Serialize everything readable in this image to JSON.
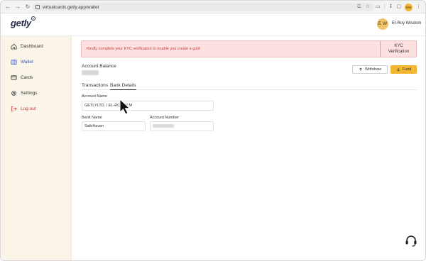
{
  "browser": {
    "url": "virtualcards.getly.app/wallet",
    "profile_initials": "EW"
  },
  "header": {
    "logo_text": "getly",
    "avatar_initials": "E W",
    "username": "El-Roy Wisdom"
  },
  "sidebar": {
    "items": [
      {
        "label": "Dashboard",
        "icon": "home-icon"
      },
      {
        "label": "Wallet",
        "icon": "wallet-icon",
        "active": true
      },
      {
        "label": "Cards",
        "icon": "card-icon"
      },
      {
        "label": "Settings",
        "icon": "gear-icon"
      },
      {
        "label": "Log out",
        "icon": "logout-icon"
      }
    ]
  },
  "main": {
    "alert": {
      "message": "Kindly complete your KYC verification to enable you create a gold",
      "kyc_button_line1": "KYC",
      "kyc_button_line2": "Verification"
    },
    "balance_label": "Account Balance",
    "withdraw_label": "Withdraw",
    "fund_label": "Fund",
    "tabs": [
      {
        "label": "Transactions"
      },
      {
        "label": "Bank Details",
        "active": true
      }
    ],
    "account_name_label": "Account Name",
    "account_name_value": "GETLYLTD. / EL-ROY W        M",
    "bank_name_label": "Bank Name",
    "bank_name_value": "SafeHaven",
    "account_number_label": "Account Number"
  },
  "colors": {
    "accent": "#f2b631",
    "active_nav": "#3b57c4",
    "alert_bg": "#fde1e1",
    "alert_text": "#c53a3a",
    "sidebar_bg": "#fbf5e9"
  }
}
